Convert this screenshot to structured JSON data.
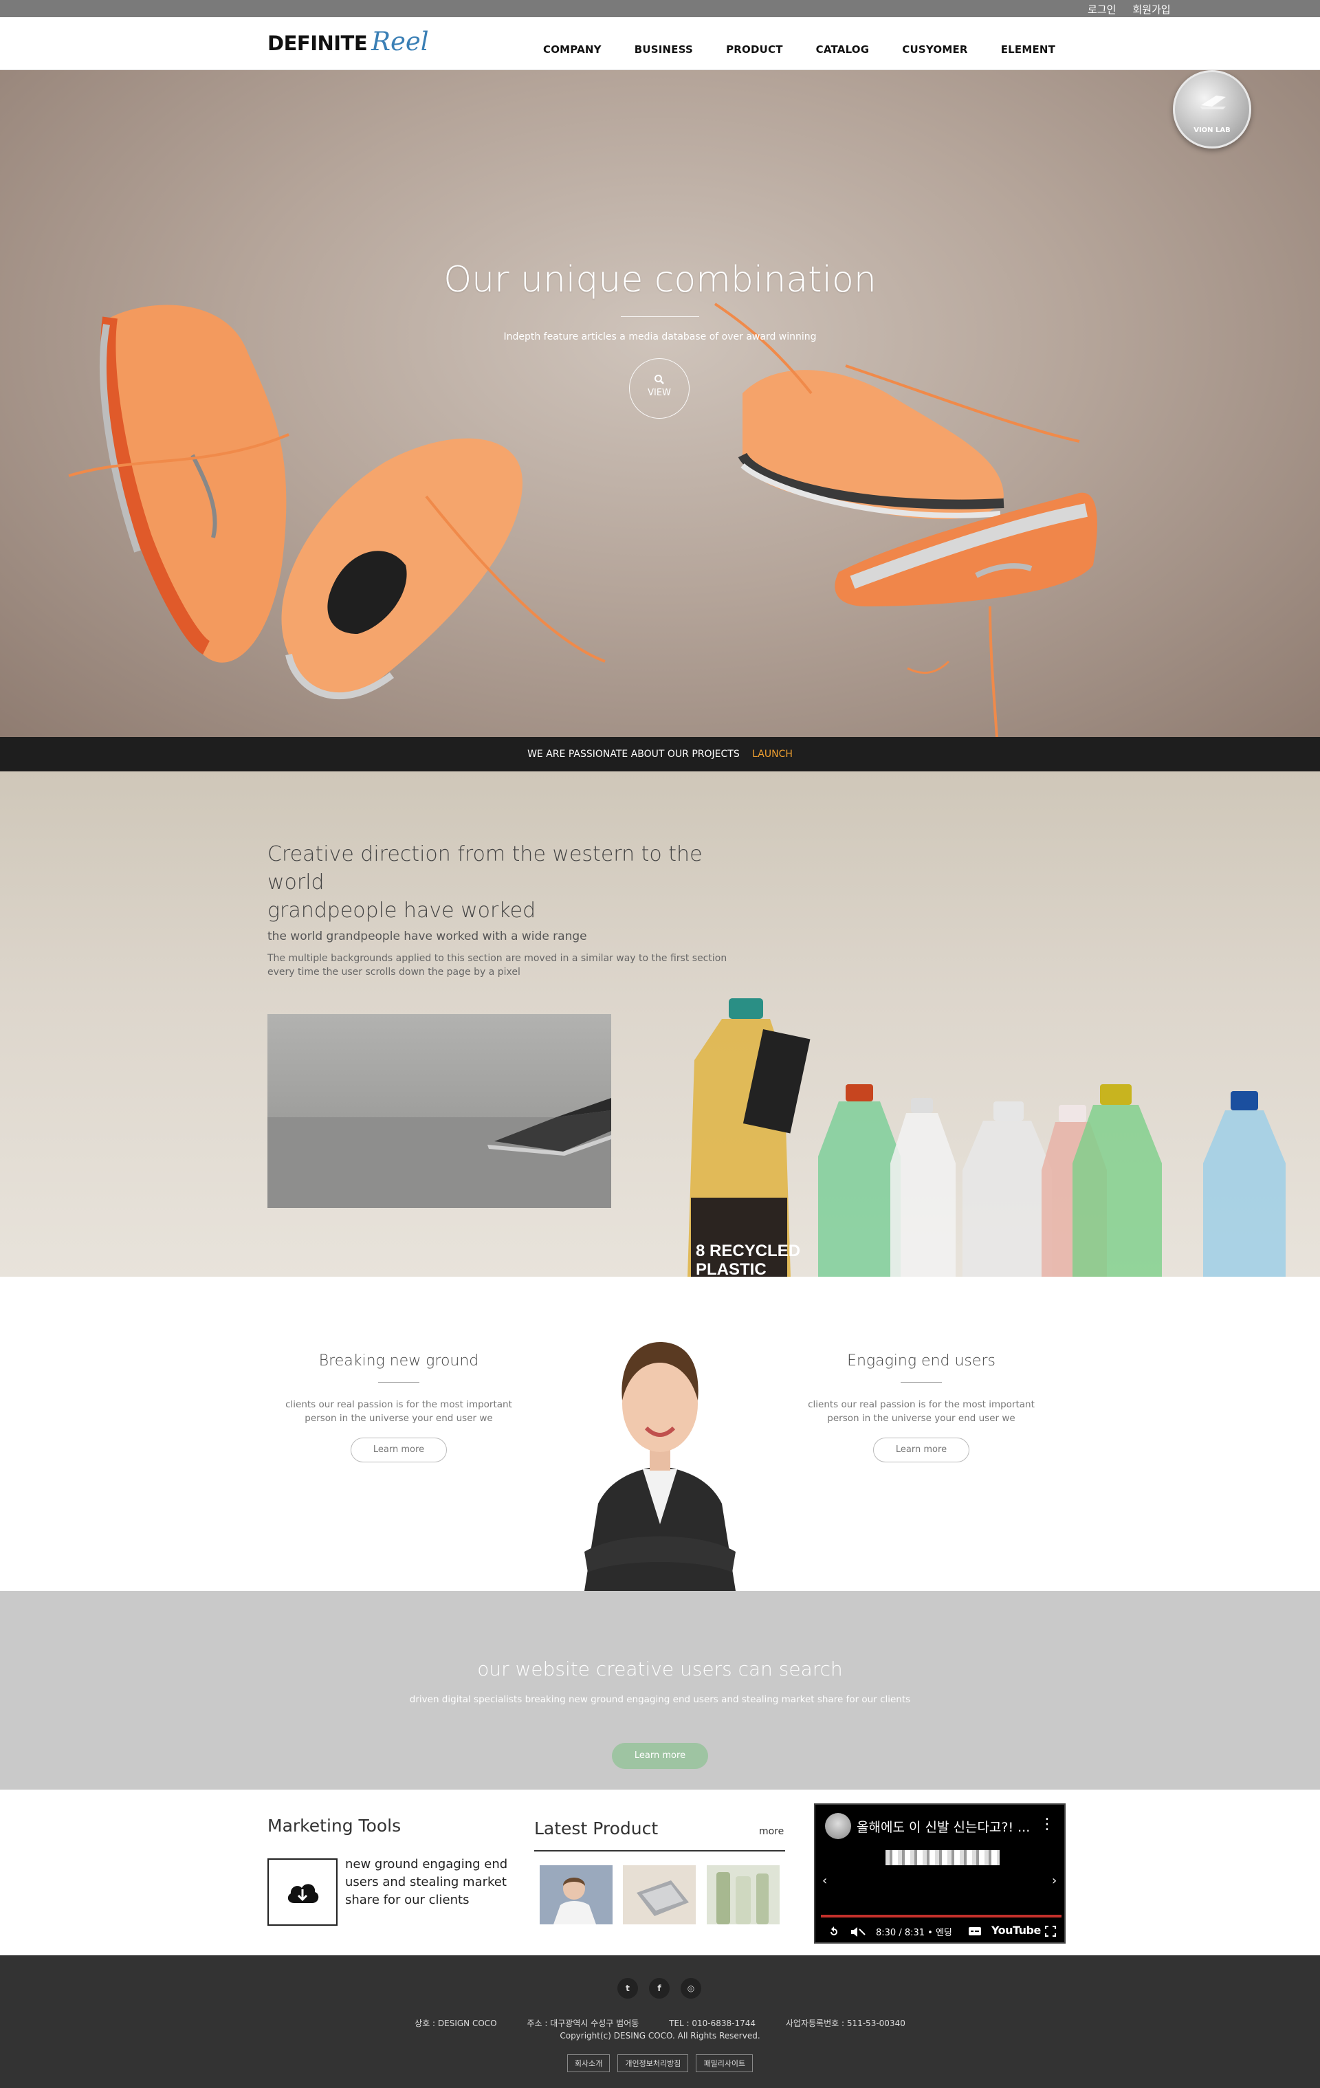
{
  "topbar": {
    "login": "로그인",
    "signup": "회원가입"
  },
  "header": {
    "logo_main": "DEFINITE",
    "logo_script": "Reel",
    "nav": [
      "COMPANY",
      "BUSINESS",
      "PRODUCT",
      "CATALOG",
      "CUSYOMER",
      "ELEMENT"
    ]
  },
  "hero": {
    "badge": "VION LAB",
    "title": "Our unique combination",
    "subtitle": "Indepth feature articles a media database of over award winning",
    "view_label": "VIEW"
  },
  "launch": {
    "text": "WE ARE PASSIONATE ABOUT OUR PROJECTS",
    "link": "LAUNCH"
  },
  "creative": {
    "heading_line1": "Creative direction from the western to the world",
    "heading_line2": "grandpeople have worked",
    "subheading": "the world grandpeople have worked with a wide range",
    "desc_line1": "The multiple backgrounds applied to this section are moved in a similar way to the first section",
    "desc_line2": "every time the user scrolls down the page by a pixel",
    "bottle_label_1": "8 RECYCLED",
    "bottle_label_2": "PLASTIC"
  },
  "features": {
    "left": {
      "title": "Breaking new ground",
      "desc_line1": "clients our real passion is for the most important",
      "desc_line2": "person in the universe your end user we",
      "button": "Learn more"
    },
    "right": {
      "title": "Engaging end users",
      "desc_line1": "clients our real passion is for the most important",
      "desc_line2": "person in the universe your end user we",
      "button": "Learn more"
    }
  },
  "search_banner": {
    "title": "our website creative users can search",
    "subtitle": "driven digital specialists breaking new ground engaging end users and stealing market share for our clients",
    "button": "Learn more"
  },
  "marketing": {
    "title": "Marketing Tools",
    "text": "new ground engaging end users and stealing market share for our clients"
  },
  "latest": {
    "title": "Latest Product",
    "more": "more"
  },
  "video": {
    "title": "올해에도 이 신발 신는다고?! ...",
    "time": "8:30 / 8:31 • 엔딩",
    "brand": "YouTube"
  },
  "footer": {
    "social": [
      "twitter-icon",
      "facebook-icon",
      "instagram-icon"
    ],
    "company": "상호 : DESIGN COCO",
    "address": "주소 : 대구광역시 수성구 범어동",
    "tel": "TEL : 010-6838-1744",
    "bizno": "사업자등록번호 : 511-53-00340",
    "copyright": "Copyright(c) DESING COCO. All Rights Reserved.",
    "buttons": [
      "회사소개",
      "개인정보처리방침",
      "패밀리사이트"
    ]
  },
  "colors": {
    "accent": "#f0a030",
    "button_green": "#9ec4a2",
    "footer_bg": "#333333",
    "video_progress": "#c4302b"
  }
}
